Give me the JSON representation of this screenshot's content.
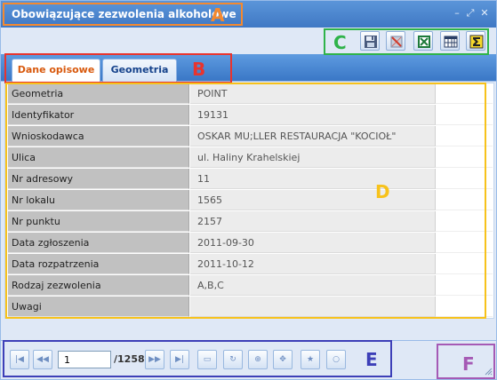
{
  "window": {
    "title": "Obowiązujące zezwolenia alkoholowe",
    "minimize_glyph": "–",
    "maximize_glyph": "⤢",
    "close_glyph": "✕"
  },
  "toolbar": {
    "tools": [
      {
        "icon": "save-attributes-icon"
      },
      {
        "icon": "delete-attributes-icon"
      },
      {
        "icon": "excel-export-icon"
      },
      {
        "icon": "table-view-icon"
      },
      {
        "icon": "sum-icon"
      }
    ]
  },
  "tabs": [
    {
      "label": "Dane opisowe",
      "active": true
    },
    {
      "label": "Geometria",
      "active": false
    }
  ],
  "grid": {
    "rows": [
      {
        "label": "Geometria",
        "value": "POINT"
      },
      {
        "label": "Identyfikator",
        "value": "19131"
      },
      {
        "label": "Wnioskodawca",
        "value": "OSKAR MU;LLER RESTAURACJA \"KOCIOŁ\""
      },
      {
        "label": "Ulica",
        "value": "ul. Haliny Krahelskiej"
      },
      {
        "label": "Nr adresowy",
        "value": "11"
      },
      {
        "label": "Nr lokalu",
        "value": "1565"
      },
      {
        "label": "Nr punktu",
        "value": "2157"
      },
      {
        "label": "Data zgłoszenia",
        "value": "2011-09-30"
      },
      {
        "label": "Data rozpatrzenia",
        "value": "2011-10-12"
      },
      {
        "label": "Rodzaj zezwolenia",
        "value": "A,B,C"
      },
      {
        "label": "Uwagi",
        "value": ""
      }
    ]
  },
  "pager": {
    "current_page": "1",
    "total_pages": "/1258",
    "buttons": [
      {
        "icon": "first-page-icon",
        "glyph": "|◀"
      },
      {
        "icon": "previous-page-icon",
        "glyph": "◀◀"
      },
      {
        "icon": "next-page-icon",
        "glyph": "▶▶"
      },
      {
        "icon": "last-page-icon",
        "glyph": "▶|"
      },
      {
        "icon": "folder-open-icon",
        "glyph": "▭"
      },
      {
        "icon": "refresh-icon",
        "glyph": "↻"
      },
      {
        "icon": "zoom-to-icon",
        "glyph": "⊕"
      },
      {
        "icon": "move-icon",
        "glyph": "✥"
      },
      {
        "icon": "star-icon",
        "glyph": "★"
      },
      {
        "icon": "circle-icon",
        "glyph": "○"
      }
    ]
  },
  "annotations": {
    "colors": {
      "A": "#f4892f",
      "B": "#e8342e",
      "C": "#2fb34a",
      "D": "#f7c21b",
      "E": "#3d3fb8",
      "F": "#a55ab5"
    },
    "letters": {
      "A": "A",
      "B": "B",
      "C": "C",
      "D": "D",
      "E": "E",
      "F": "F"
    }
  }
}
